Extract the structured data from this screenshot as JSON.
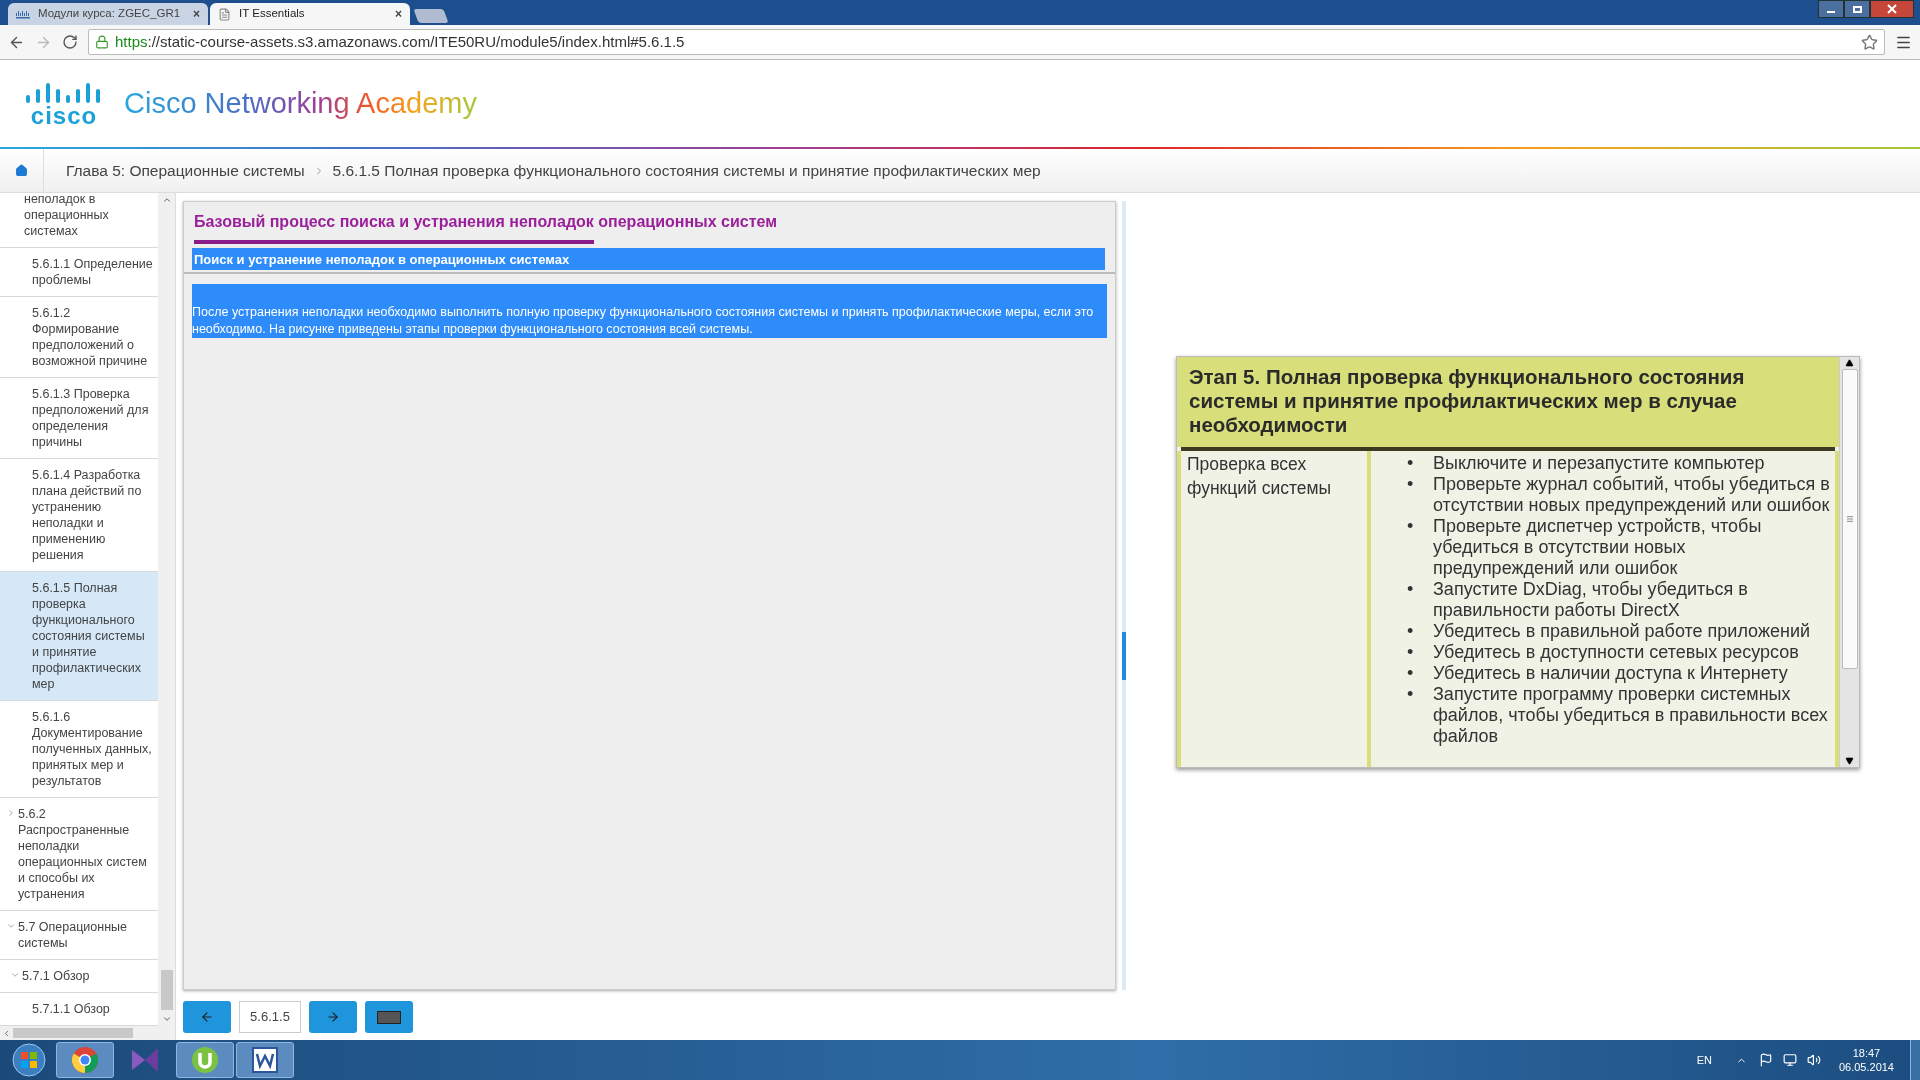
{
  "browser": {
    "tabs": [
      {
        "label": "Модули курса: ZGEC_GR1",
        "selected": false,
        "close": "×"
      },
      {
        "label": "IT Essentials",
        "selected": true,
        "close": "×"
      }
    ],
    "url_scheme": "https",
    "url_rest": "://static-course-assets.s3.amazonaws.com/ITE50RU/module5/index.html#5.6.1.5"
  },
  "header": {
    "logo": "cisco",
    "title": "Cisco Networking Academy"
  },
  "breadcrumb": [
    "Глава 5: Операционные системы",
    "5.6.1.5 Полная проверка функционального состояния системы и принятие профилактических мер"
  ],
  "sidebar": {
    "items": [
      {
        "label": "неполадок в операционных системах",
        "expanded": true,
        "children": [
          {
            "label": "5.6.1.1 Определение проблемы",
            "selected": false
          },
          {
            "label": "5.6.1.2 Формирование предположений о возможной причине",
            "selected": false
          },
          {
            "label": "5.6.1.3 Проверка предположений для определения причины",
            "selected": false
          },
          {
            "label": "5.6.1.4 Разработка плана действий по устранению неполадки и применению решения",
            "selected": false
          },
          {
            "label": "5.6.1.5 Полная проверка функционального состояния системы и принятие профилактических мер",
            "selected": true
          },
          {
            "label": "5.6.1.6 Документирование полученных данных, принятых мер и результатов",
            "selected": false
          }
        ]
      },
      {
        "label": "5.6.2 Распространенные неполадки операционных систем и способы их устранения",
        "expanded": false
      },
      {
        "label": "5.7 Операционные системы",
        "expanded": true,
        "children": [
          {
            "label": "5.7.1 Обзор",
            "expanded": true,
            "children": [
              {
                "label": "5.7.1.1 Обзор",
                "selected": false
              }
            ]
          }
        ]
      }
    ]
  },
  "content": {
    "title": "Базовый процесс поиска и устранения неполадок операционных систем",
    "section": "Поиск и устранение неполадок в операционных системах",
    "paragraph": "После устранения неполадки необходимо выполнить полную проверку функционального состояния системы и принять профилактические меры, если это необходимо. На рисунке приведены этапы проверки функционального состояния всей системы."
  },
  "figure": {
    "heading": "Этап 5. Полная проверка функционального состояния системы и принятие профилактических мер в случае необходимости",
    "row_label": "Проверка всех функций системы",
    "bullets": [
      "Выключите и перезапустите компьютер",
      "Проверьте журнал событий, чтобы убедиться в отсутствии новых предупреждений или ошибок",
      "Проверьте диспетчер устройств, чтобы убедиться в отсутствии новых предупреждений или ошибок",
      "Запустите DxDiag, чтобы убедиться в правильности работы DirectX",
      "Убедитесь в правильной работе приложений",
      "Убедитесь в доступности сетевых ресурсов",
      "Убедитесь в наличии доступа к Интернету",
      "Запустите программу проверки системных файлов, чтобы убедиться в правильности всех файлов"
    ],
    "bullet_mark": "•"
  },
  "nav": {
    "page": "5.6.1.5"
  },
  "taskbar": {
    "language": "EN",
    "time": "18:47",
    "date": "06.05.2014"
  }
}
